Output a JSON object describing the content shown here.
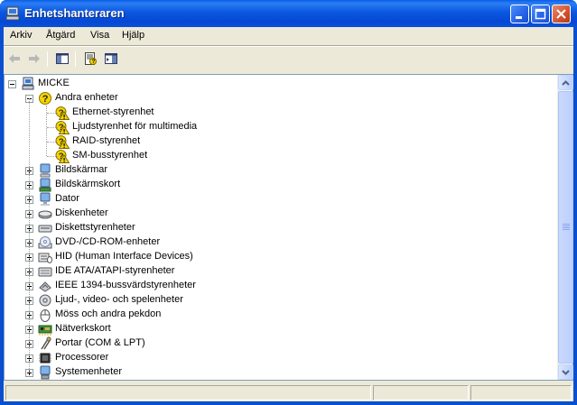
{
  "window": {
    "title": "Enhetshanteraren"
  },
  "menu": {
    "items": [
      "Arkiv",
      "Åtgärd",
      "Visa",
      "Hjälp"
    ]
  },
  "tree": {
    "root": "MICKE",
    "other_devices": {
      "label": "Andra enheter",
      "children": [
        "Ethernet-styrenhet",
        "Ljudstyrenhet för multimedia",
        "RAID-styrenhet",
        "SM-busstyrenhet"
      ]
    },
    "categories": [
      "Bildskärmar",
      "Bildskärmskort",
      "Dator",
      "Diskenheter",
      "Diskettstyrenheter",
      "DVD-/CD-ROM-enheter",
      "HID (Human Interface Devices)",
      "IDE ATA/ATAPI-styrenheter",
      "IEEE 1394-bussvärdstyrenheter",
      "Ljud-, video- och spelenheter",
      "Möss och andra pekdon",
      "Nätverkskort",
      "Portar (COM & LPT)",
      "Processorer",
      "Systemenheter"
    ]
  },
  "colors": {
    "titlebar": "#0b57e0",
    "face": "#ece9d8",
    "warning": "#f5d400"
  }
}
